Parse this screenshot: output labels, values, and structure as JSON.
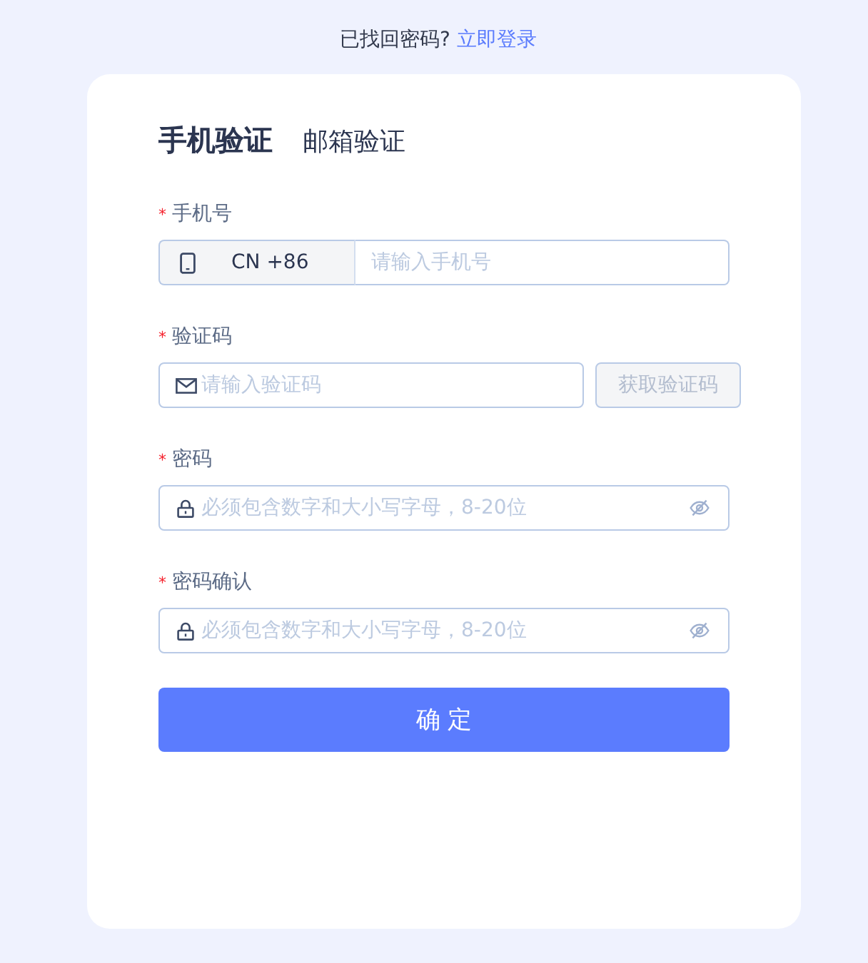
{
  "top_prompt": {
    "text": "已找回密码?",
    "link": "立即登录"
  },
  "tabs": [
    {
      "label": "手机验证",
      "selected": true
    },
    {
      "label": "邮箱验证",
      "selected": false
    }
  ],
  "fields": [
    {
      "kind": "phone",
      "required_mark": "*",
      "label": "手机号",
      "country": "CN +86",
      "placeholder": "请输入手机号"
    },
    {
      "kind": "code",
      "required_mark": "*",
      "label": "验证码",
      "placeholder": "请输入验证码",
      "action": {
        "label": "获取验证码",
        "disabled": true
      }
    },
    {
      "kind": "password",
      "required_mark": "*",
      "label": "密码",
      "placeholder": "必须包含数字和大小写字母，8-20位"
    },
    {
      "kind": "password",
      "required_mark": "*",
      "label": "密码确认",
      "placeholder": "必须包含数字和大小写字母，8-20位"
    }
  ],
  "submit": {
    "label": "确 定"
  }
}
